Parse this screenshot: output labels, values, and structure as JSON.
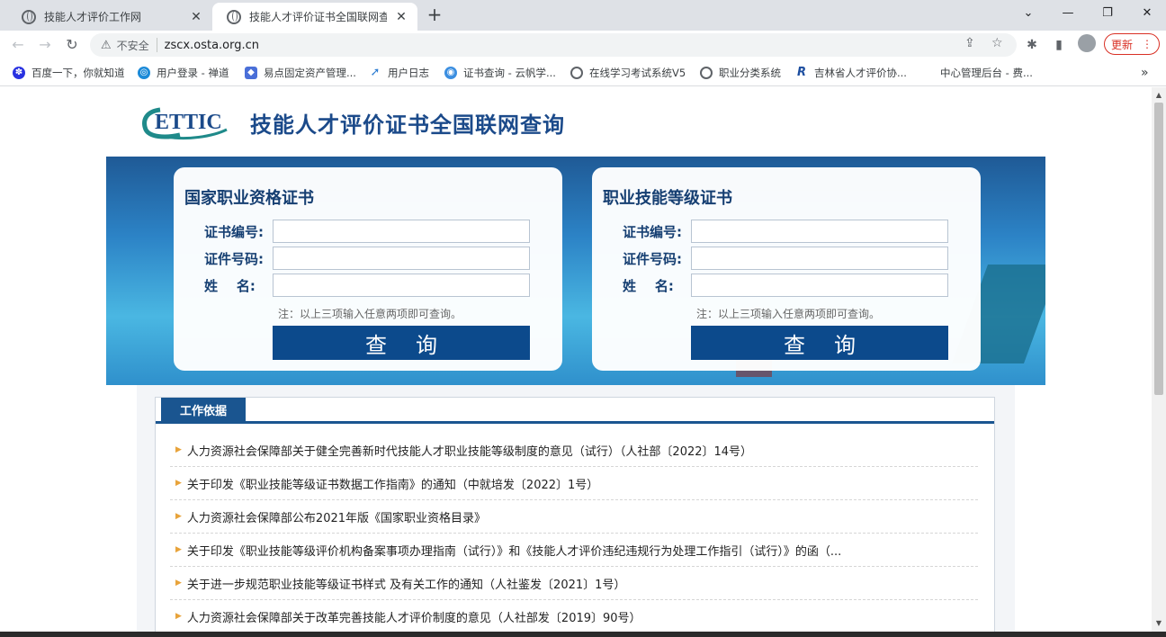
{
  "browser": {
    "tabs": [
      {
        "title": "技能人才评价工作网",
        "active": false
      },
      {
        "title": "技能人才评价证书全国联网查询 ",
        "active": true
      }
    ],
    "new_tab": "+",
    "window_controls": {
      "collapse": "⌄",
      "minimize": "—",
      "restore": "❐",
      "close": "✕"
    },
    "omnibox": {
      "security": "不安全",
      "url": "zscx.osta.org.cn"
    },
    "update_label": "更新",
    "bookmarks": [
      {
        "label": "百度一下，你就知道",
        "icon": "baidu-icon",
        "color": "#2932e1"
      },
      {
        "label": "用户登录 - 禅道",
        "icon": "zentao-icon",
        "color": "#1b8ad8"
      },
      {
        "label": "易点固定资产管理...",
        "icon": "asset-icon",
        "color": "#4a6fd8"
      },
      {
        "label": "用户日志",
        "icon": "log-icon",
        "color": "#2d7dd2"
      },
      {
        "label": "证书查询 - 云帆学...",
        "icon": "cert-icon",
        "color": "#3b8ee0"
      },
      {
        "label": "在线学习考试系统V5",
        "icon": "globe-icon",
        "color": "#5f6368"
      },
      {
        "label": "职业分类系统",
        "icon": "globe-icon",
        "color": "#5f6368"
      },
      {
        "label": "吉林省人才评价协...",
        "icon": "r-icon",
        "color": "#1e4fa0"
      },
      {
        "label": "中心管理后台 - 费...",
        "icon": "blank-icon",
        "color": "#ffffff"
      }
    ],
    "bookmarks_more": "»"
  },
  "site": {
    "logo_text": "ETTIC",
    "title": "技能人才评价证书全国联网查询"
  },
  "panels": [
    {
      "title": "国家职业资格证书",
      "fields": [
        {
          "label": "证书编号:",
          "value": ""
        },
        {
          "label": "证件号码:",
          "value": ""
        },
        {
          "label": "姓    名:",
          "value": ""
        }
      ],
      "note": "注：以上三项输入任意两项即可查询。",
      "button": "查询"
    },
    {
      "title": "职业技能等级证书",
      "fields": [
        {
          "label": "证书编号:",
          "value": ""
        },
        {
          "label": "证件号码:",
          "value": ""
        },
        {
          "label": "姓    名:",
          "value": ""
        }
      ],
      "note": "注：以上三项输入任意两项即可查询。",
      "button": "查询"
    }
  ],
  "work_basis": {
    "tab_label": "工作依据",
    "items": [
      "人力资源社会保障部关于健全完善新时代技能人才职业技能等级制度的意见（试行）（人社部〔2022〕14号）",
      "关于印发《职业技能等级证书数据工作指南》的通知（中就培发〔2022〕1号）",
      "人力资源社会保障部公布2021年版《国家职业资格目录》",
      "关于印发《职业技能等级评价机构备案事项办理指南（试行）》和《技能人才评价违纪违规行为处理工作指引（试行）》的函（...",
      "关于进一步规范职业技能等级证书样式 及有关工作的通知（人社鉴发〔2021〕1号）",
      "人力资源社会保障部关于改革完善技能人才评价制度的意见（人社部发〔2019〕90号）"
    ]
  }
}
